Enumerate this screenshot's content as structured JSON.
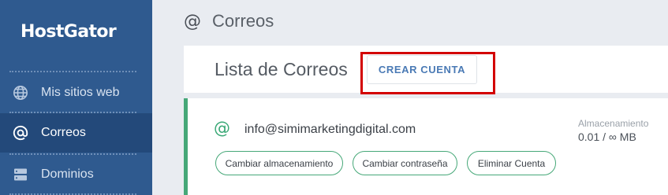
{
  "sidebar": {
    "brand": "HostGator",
    "items": [
      {
        "label": "Mis sitios web",
        "icon": "globe-icon",
        "active": false
      },
      {
        "label": "Correos",
        "icon": "at-icon",
        "active": true
      },
      {
        "label": "Dominios",
        "icon": "server-icon",
        "active": false
      }
    ]
  },
  "header": {
    "icon": "@",
    "title": "Correos"
  },
  "list": {
    "title": "Lista de Correos",
    "create_button": "CREAR CUENTA"
  },
  "account": {
    "email": "info@simimarketingdigital.com",
    "storage_label": "Almacenamiento",
    "storage_value": "0.01 / ∞ MB",
    "actions": [
      "Cambiar almacenamiento",
      "Cambiar contraseña",
      "Eliminar Cuenta"
    ]
  },
  "colors": {
    "sidebar": "#2f5a8f",
    "accent_green": "#46a878",
    "highlight": "#d30000",
    "button_text": "#4a7ab5"
  }
}
